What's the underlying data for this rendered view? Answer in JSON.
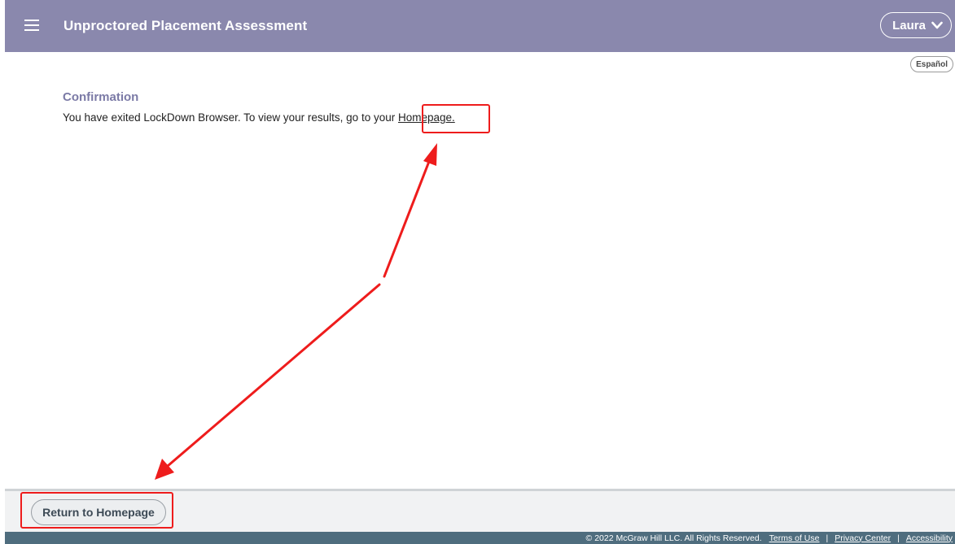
{
  "header": {
    "title": "Unproctored Placement Assessment",
    "menu_icon": "hamburger-menu-icon",
    "user_name": "Laura",
    "user_menu_icon": "chevron-down-icon",
    "background_color": "#8a88ad"
  },
  "language_toggle": {
    "label": "Español"
  },
  "confirmation": {
    "heading": "Confirmation",
    "message": "You have exited LockDown Browser. To view your results, go to your ",
    "link_label": "Homepage."
  },
  "footer": {
    "return_button_label": "Return to Homepage",
    "copyright": "© 2022 McGraw Hill LLC. All Rights Reserved.",
    "links": [
      "Terms of Use",
      "Privacy Center",
      "Accessibility"
    ],
    "separator": "|"
  },
  "annotations": {
    "highlight_color": "#ee1c1c"
  }
}
